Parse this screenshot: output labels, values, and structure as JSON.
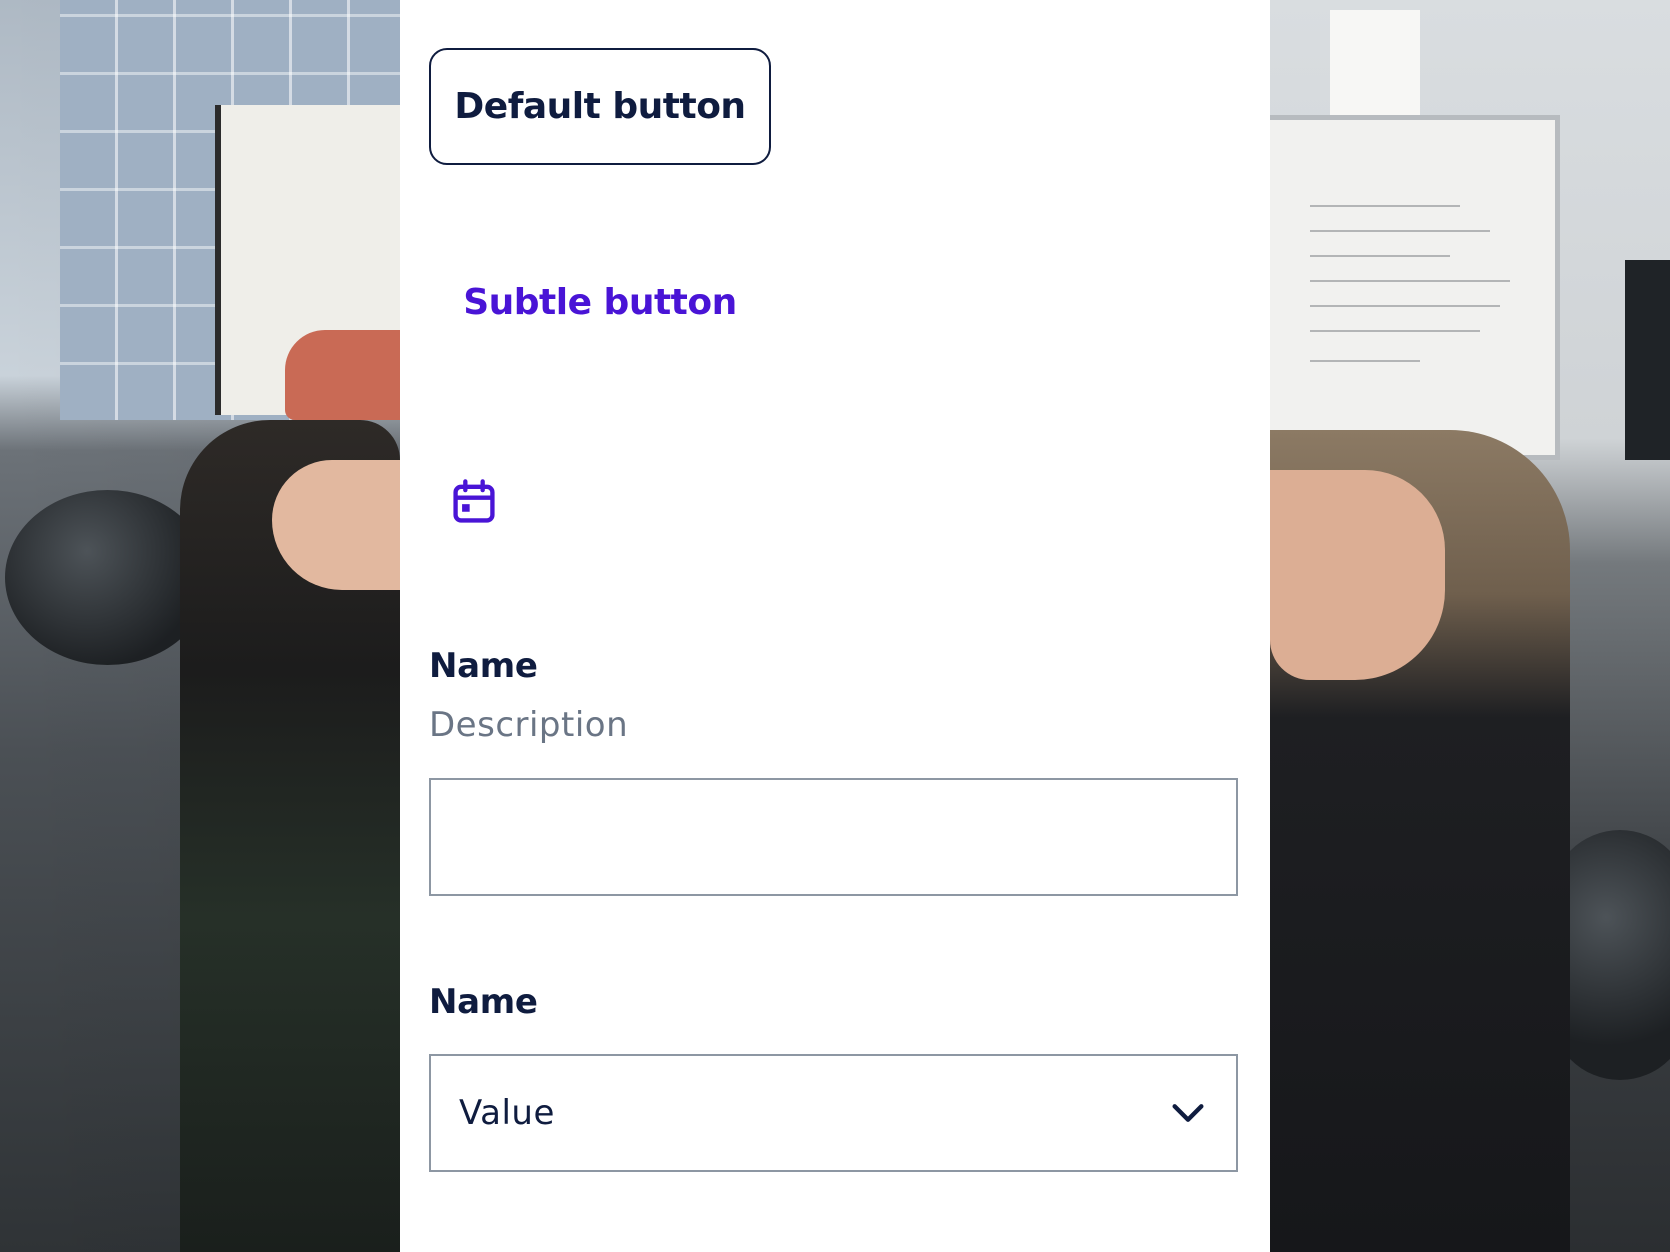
{
  "buttons": {
    "default_label": "Default button",
    "subtle_label": "Subtle button",
    "calendar_icon": "calendar-icon"
  },
  "form": {
    "input_field": {
      "label": "Name",
      "description": "Description",
      "value": "",
      "placeholder": ""
    },
    "select_field": {
      "label": "Name",
      "value": "Value",
      "icon": "chevron-down-icon"
    }
  },
  "colors": {
    "text_primary": "#0f1c3f",
    "accent": "#4914d6",
    "muted": "#6a7585",
    "border": "#8d97a3",
    "panel": "#ffffff"
  }
}
